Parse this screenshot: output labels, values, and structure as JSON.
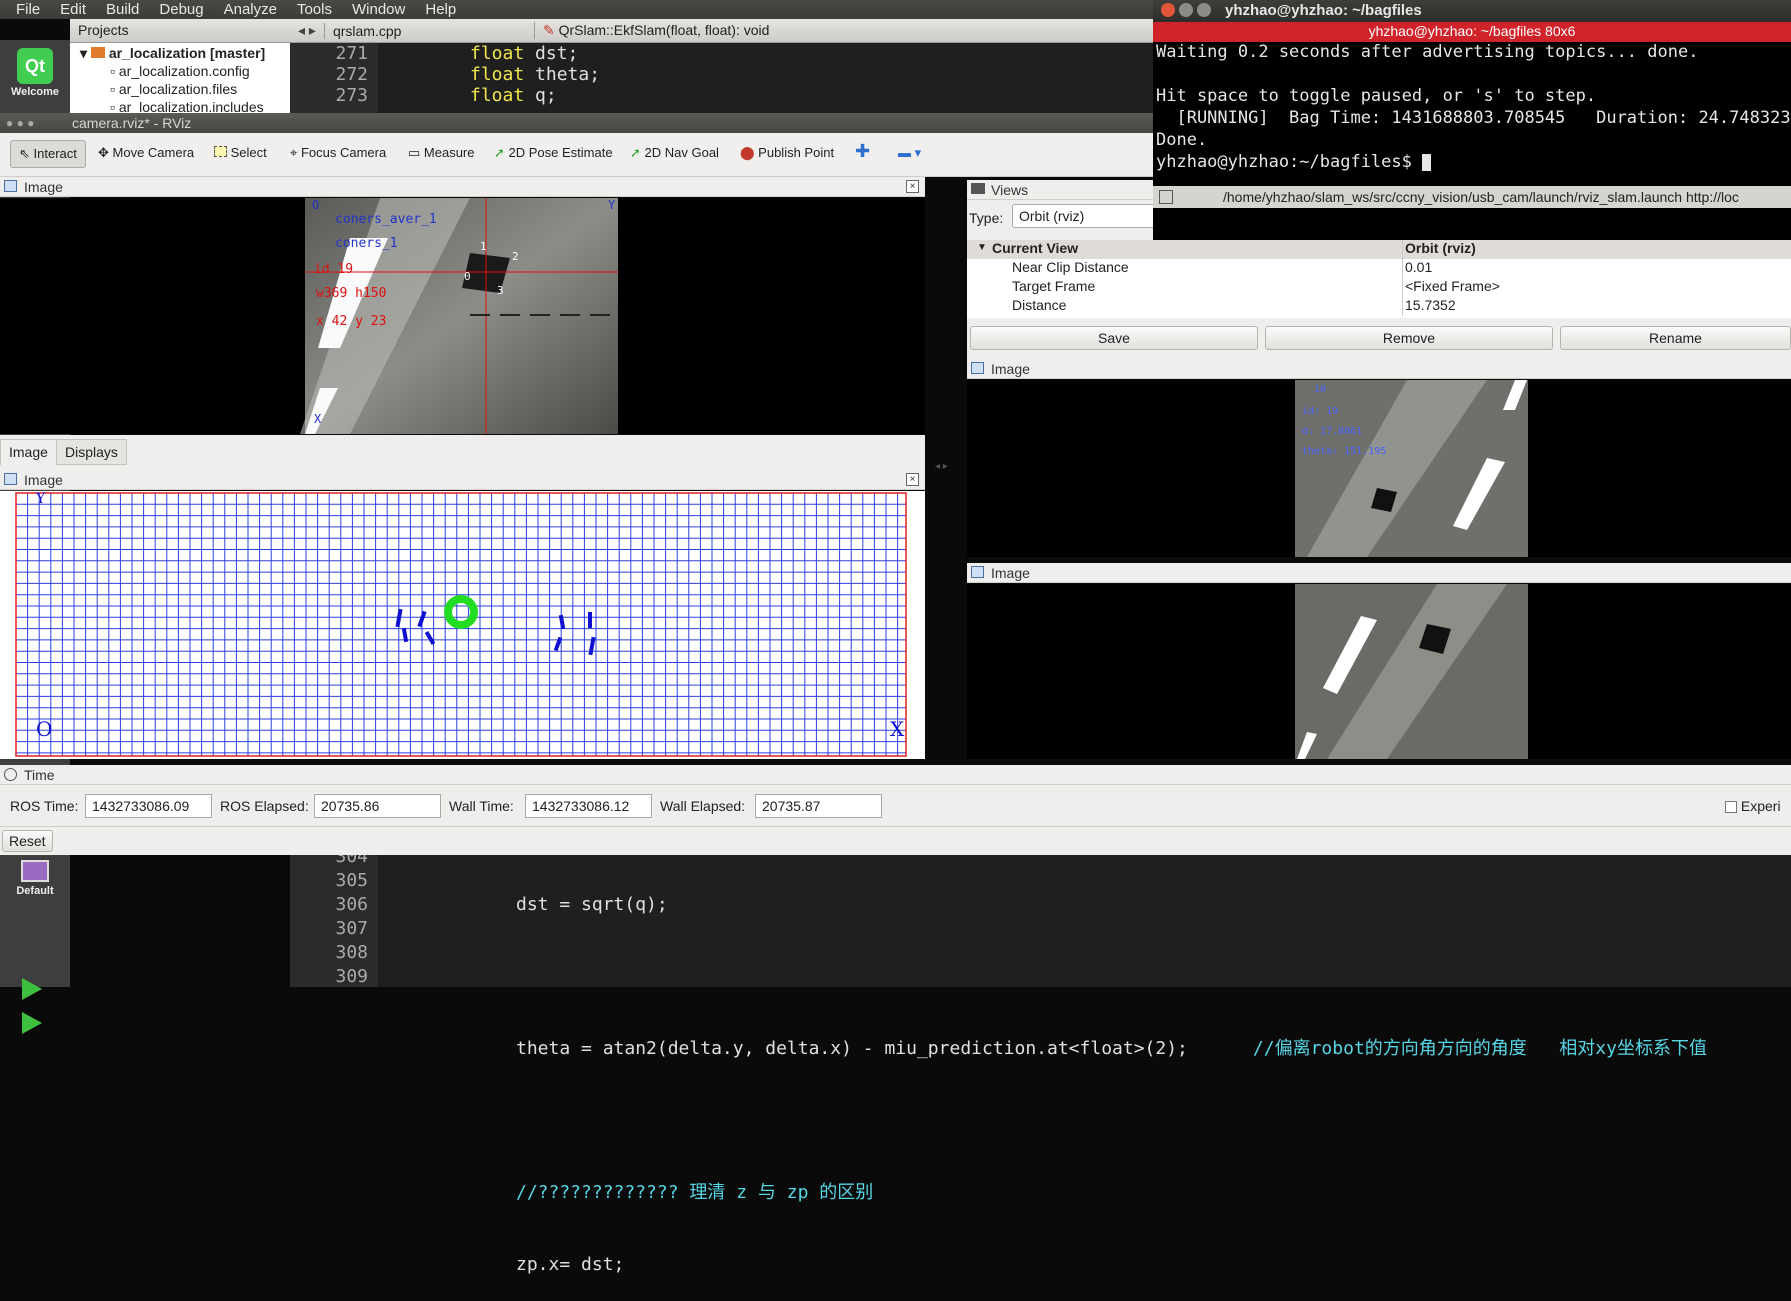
{
  "qtcreator": {
    "menu": [
      "File",
      "Edit",
      "Build",
      "Debug",
      "Analyze",
      "Tools",
      "Window",
      "Help"
    ],
    "modes": [
      {
        "label": "Welcome",
        "icon": "qt-logo-icon"
      },
      {
        "label": "Default",
        "icon": "monitor-icon"
      }
    ],
    "projects_label": "Projects",
    "tree": [
      "ar_localization [master]",
      "ar_localization.config",
      "ar_localization.files",
      "ar_localization.includes"
    ],
    "file_tab": "qrslam.cpp",
    "function_combo": "QrSlam::EkfSlam(float, float): void",
    "top_lines": [
      {
        "n": "271",
        "kw": "float",
        "rest": " dst;"
      },
      {
        "n": "272",
        "kw": "float",
        "rest": " theta;"
      },
      {
        "n": "273",
        "kw": "float",
        "rest": " q;"
      }
    ],
    "bottom_lines": [
      {
        "n": "304",
        "code": "dst = sqrt(q);"
      },
      {
        "n": "305",
        "code": ""
      },
      {
        "n": "306",
        "code": "theta = atan2(delta.y, delta.x) - miu_prediction.at<float>(2);",
        "comment": "//偏离robot的方向角方向的角度   相对xy坐标系下值"
      },
      {
        "n": "307",
        "code": ""
      },
      {
        "n": "308",
        "code": "",
        "comment": "//????????????? 理清 z 与 zp 的区别"
      },
      {
        "n": "309",
        "code": "zp.x= dst;"
      }
    ]
  },
  "rviz": {
    "title": "camera.rviz* - RViz",
    "tools": [
      "Interact",
      "Move Camera",
      "Select",
      "Focus Camera",
      "Measure",
      "2D Pose Estimate",
      "2D Nav Goal",
      "Publish Point"
    ],
    "image_label": "Image",
    "overlay_a": [
      "coners_aver_1",
      "coners_1",
      "id 19",
      "w369  h150",
      "x  42  y  23",
      "2",
      "1",
      "0",
      "3",
      "O",
      "Y",
      "X"
    ],
    "tabs": [
      "Image",
      "Displays"
    ],
    "grid_b": {
      "axis_o": "O",
      "axis_x": "X",
      "axis_y": "Y"
    },
    "views": {
      "header": "Views",
      "type_label": "Type:",
      "type_value": "Orbit (rviz)",
      "rows": [
        {
          "k": "Current View",
          "v": "Orbit (rviz)"
        },
        {
          "k": "Near Clip Distance",
          "v": "0.01"
        },
        {
          "k": "Target Frame",
          "v": "<Fixed Frame>"
        },
        {
          "k": "Distance",
          "v": "15.7352"
        }
      ],
      "buttons": [
        "Save",
        "Remove",
        "Rename"
      ]
    },
    "overlay_c": [
      "10",
      "id: 19",
      "d: 17.0861",
      "theta:  151.195"
    ],
    "time": {
      "header": "Time",
      "ros_time_label": "ROS Time:",
      "ros_time": "1432733086.09",
      "ros_elapsed_label": "ROS Elapsed:",
      "ros_elapsed": "20735.86",
      "wall_time_label": "Wall Time:",
      "wall_time": "1432733086.12",
      "wall_elapsed_label": "Wall Elapsed:",
      "wall_elapsed": "20735.87",
      "reset": "Reset",
      "experimental": "Experi"
    }
  },
  "terminal": {
    "title": "yhzhao@yhzhao: ~/bagfiles",
    "subtitle": "yhzhao@yhzhao: ~/bagfiles 80x6",
    "lines": [
      "Waiting 0.2 seconds after advertising topics... done.",
      "",
      "Hit space to toggle paused, or 's' to step.",
      "  [RUNNING]  Bag Time: 1431688803.708545   Duration: 24.748323 /",
      "Done.",
      "yhzhao@yhzhao:~/bagfiles$ "
    ],
    "statusbar": "/home/yhzhao/slam_ws/src/ccny_vision/usb_cam/launch/rviz_slam.launch http://loc"
  }
}
